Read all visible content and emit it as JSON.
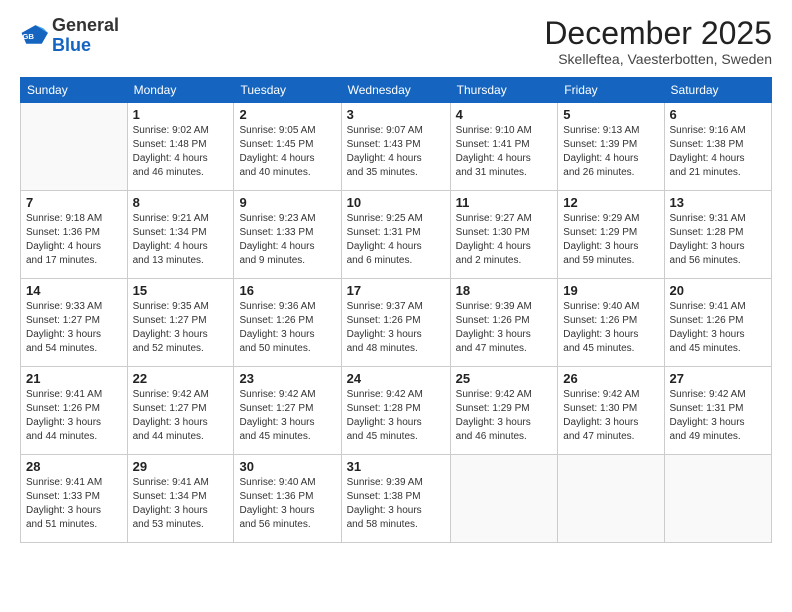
{
  "logo": {
    "general": "General",
    "blue": "Blue"
  },
  "title": "December 2025",
  "subtitle": "Skelleftea, Vaesterbotten, Sweden",
  "days": [
    "Sunday",
    "Monday",
    "Tuesday",
    "Wednesday",
    "Thursday",
    "Friday",
    "Saturday"
  ],
  "weeks": [
    [
      {
        "num": "",
        "info": ""
      },
      {
        "num": "1",
        "info": "Sunrise: 9:02 AM\nSunset: 1:48 PM\nDaylight: 4 hours\nand 46 minutes."
      },
      {
        "num": "2",
        "info": "Sunrise: 9:05 AM\nSunset: 1:45 PM\nDaylight: 4 hours\nand 40 minutes."
      },
      {
        "num": "3",
        "info": "Sunrise: 9:07 AM\nSunset: 1:43 PM\nDaylight: 4 hours\nand 35 minutes."
      },
      {
        "num": "4",
        "info": "Sunrise: 9:10 AM\nSunset: 1:41 PM\nDaylight: 4 hours\nand 31 minutes."
      },
      {
        "num": "5",
        "info": "Sunrise: 9:13 AM\nSunset: 1:39 PM\nDaylight: 4 hours\nand 26 minutes."
      },
      {
        "num": "6",
        "info": "Sunrise: 9:16 AM\nSunset: 1:38 PM\nDaylight: 4 hours\nand 21 minutes."
      }
    ],
    [
      {
        "num": "7",
        "info": "Sunrise: 9:18 AM\nSunset: 1:36 PM\nDaylight: 4 hours\nand 17 minutes."
      },
      {
        "num": "8",
        "info": "Sunrise: 9:21 AM\nSunset: 1:34 PM\nDaylight: 4 hours\nand 13 minutes."
      },
      {
        "num": "9",
        "info": "Sunrise: 9:23 AM\nSunset: 1:33 PM\nDaylight: 4 hours\nand 9 minutes."
      },
      {
        "num": "10",
        "info": "Sunrise: 9:25 AM\nSunset: 1:31 PM\nDaylight: 4 hours\nand 6 minutes."
      },
      {
        "num": "11",
        "info": "Sunrise: 9:27 AM\nSunset: 1:30 PM\nDaylight: 4 hours\nand 2 minutes."
      },
      {
        "num": "12",
        "info": "Sunrise: 9:29 AM\nSunset: 1:29 PM\nDaylight: 3 hours\nand 59 minutes."
      },
      {
        "num": "13",
        "info": "Sunrise: 9:31 AM\nSunset: 1:28 PM\nDaylight: 3 hours\nand 56 minutes."
      }
    ],
    [
      {
        "num": "14",
        "info": "Sunrise: 9:33 AM\nSunset: 1:27 PM\nDaylight: 3 hours\nand 54 minutes."
      },
      {
        "num": "15",
        "info": "Sunrise: 9:35 AM\nSunset: 1:27 PM\nDaylight: 3 hours\nand 52 minutes."
      },
      {
        "num": "16",
        "info": "Sunrise: 9:36 AM\nSunset: 1:26 PM\nDaylight: 3 hours\nand 50 minutes."
      },
      {
        "num": "17",
        "info": "Sunrise: 9:37 AM\nSunset: 1:26 PM\nDaylight: 3 hours\nand 48 minutes."
      },
      {
        "num": "18",
        "info": "Sunrise: 9:39 AM\nSunset: 1:26 PM\nDaylight: 3 hours\nand 47 minutes."
      },
      {
        "num": "19",
        "info": "Sunrise: 9:40 AM\nSunset: 1:26 PM\nDaylight: 3 hours\nand 45 minutes."
      },
      {
        "num": "20",
        "info": "Sunrise: 9:41 AM\nSunset: 1:26 PM\nDaylight: 3 hours\nand 45 minutes."
      }
    ],
    [
      {
        "num": "21",
        "info": "Sunrise: 9:41 AM\nSunset: 1:26 PM\nDaylight: 3 hours\nand 44 minutes."
      },
      {
        "num": "22",
        "info": "Sunrise: 9:42 AM\nSunset: 1:27 PM\nDaylight: 3 hours\nand 44 minutes."
      },
      {
        "num": "23",
        "info": "Sunrise: 9:42 AM\nSunset: 1:27 PM\nDaylight: 3 hours\nand 45 minutes."
      },
      {
        "num": "24",
        "info": "Sunrise: 9:42 AM\nSunset: 1:28 PM\nDaylight: 3 hours\nand 45 minutes."
      },
      {
        "num": "25",
        "info": "Sunrise: 9:42 AM\nSunset: 1:29 PM\nDaylight: 3 hours\nand 46 minutes."
      },
      {
        "num": "26",
        "info": "Sunrise: 9:42 AM\nSunset: 1:30 PM\nDaylight: 3 hours\nand 47 minutes."
      },
      {
        "num": "27",
        "info": "Sunrise: 9:42 AM\nSunset: 1:31 PM\nDaylight: 3 hours\nand 49 minutes."
      }
    ],
    [
      {
        "num": "28",
        "info": "Sunrise: 9:41 AM\nSunset: 1:33 PM\nDaylight: 3 hours\nand 51 minutes."
      },
      {
        "num": "29",
        "info": "Sunrise: 9:41 AM\nSunset: 1:34 PM\nDaylight: 3 hours\nand 53 minutes."
      },
      {
        "num": "30",
        "info": "Sunrise: 9:40 AM\nSunset: 1:36 PM\nDaylight: 3 hours\nand 56 minutes."
      },
      {
        "num": "31",
        "info": "Sunrise: 9:39 AM\nSunset: 1:38 PM\nDaylight: 3 hours\nand 58 minutes."
      },
      {
        "num": "",
        "info": ""
      },
      {
        "num": "",
        "info": ""
      },
      {
        "num": "",
        "info": ""
      }
    ]
  ]
}
